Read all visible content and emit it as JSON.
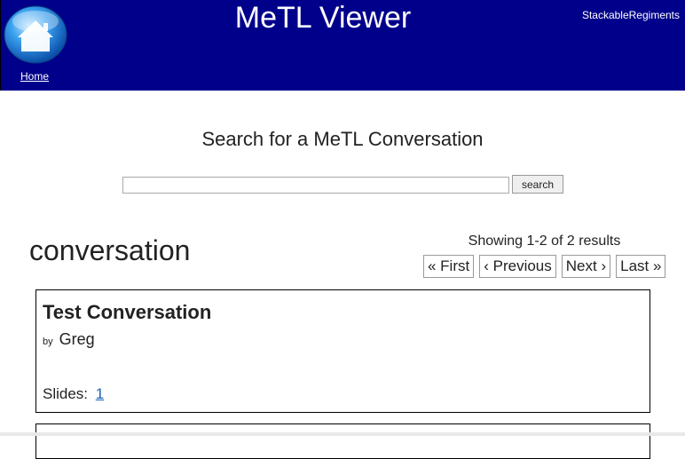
{
  "header": {
    "title": "MeTL Viewer",
    "home_label": "Home",
    "username": "StackableRegiments",
    "home_icon": "house-icon",
    "brand_color": "#00008b"
  },
  "search": {
    "title": "Search for a MeTL Conversation",
    "query": "",
    "placeholder": "",
    "button_label": "search"
  },
  "results": {
    "heading": "conversation",
    "summary": "Showing 1-2 of 2 results",
    "pager": {
      "first": "« First",
      "previous": "‹ Previous",
      "next": "Next ›",
      "last": "Last »"
    },
    "items": [
      {
        "title": "Test Conversation",
        "by_prefix": "by",
        "author": "Greg",
        "slides_label": "Slides:",
        "slides": [
          "1"
        ]
      }
    ]
  }
}
